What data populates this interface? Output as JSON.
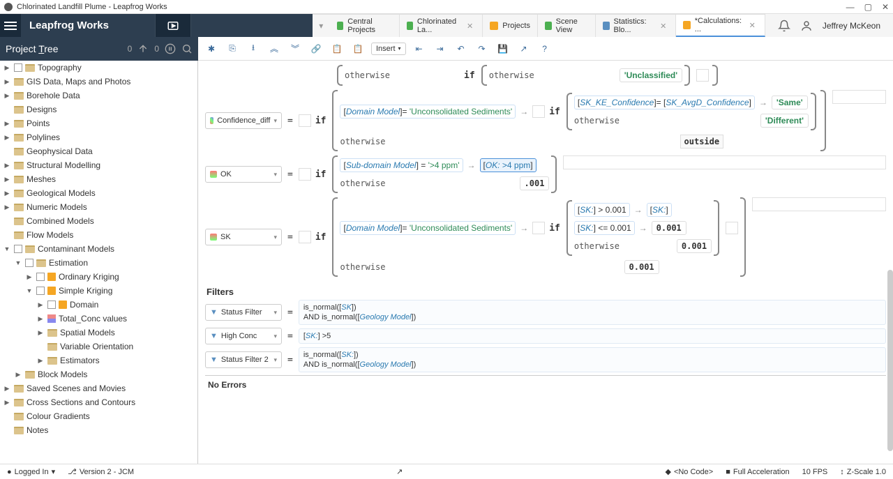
{
  "window": {
    "title": "Chlorinated Landfill Plume - Leapfrog Works",
    "app_name": "Leapfrog Works"
  },
  "user": {
    "name": "Jeffrey McKeon"
  },
  "sidebar": {
    "title_prefix": "Project ",
    "title_underline": "T",
    "title_suffix": "ree",
    "counts": [
      "0",
      "0"
    ]
  },
  "tabs": [
    {
      "label": "Central Projects",
      "color": "#4caf50",
      "closable": false
    },
    {
      "label": "Chlorinated La...",
      "color": "#4caf50",
      "closable": true
    },
    {
      "label": "Projects",
      "color": "#f5a623",
      "closable": false
    },
    {
      "label": "Scene View",
      "color": "#4caf50",
      "closable": false
    },
    {
      "label": "Statistics: Blo...",
      "color": "#5a8fc0",
      "closable": true
    },
    {
      "label": "*Calculations: ...",
      "color": "#f5a623",
      "closable": true,
      "active": true
    }
  ],
  "toolbar": {
    "insert": "Insert"
  },
  "tree": [
    {
      "label": "Topography",
      "indent": 0,
      "expander": "▶",
      "checkbox": true,
      "icon": "folder"
    },
    {
      "label": "GIS Data, Maps and Photos",
      "indent": 0,
      "expander": "▶",
      "checkbox": false,
      "icon": "folder"
    },
    {
      "label": "Borehole Data",
      "indent": 0,
      "expander": "▶",
      "checkbox": false,
      "icon": "folder"
    },
    {
      "label": "Designs",
      "indent": 0,
      "expander": "",
      "checkbox": false,
      "icon": "folder"
    },
    {
      "label": "Points",
      "indent": 0,
      "expander": "▶",
      "checkbox": false,
      "icon": "folder"
    },
    {
      "label": "Polylines",
      "indent": 0,
      "expander": "▶",
      "checkbox": false,
      "icon": "folder"
    },
    {
      "label": "Geophysical Data",
      "indent": 0,
      "expander": "",
      "checkbox": false,
      "icon": "folder"
    },
    {
      "label": "Structural Modelling",
      "indent": 0,
      "expander": "▶",
      "checkbox": false,
      "icon": "folder"
    },
    {
      "label": "Meshes",
      "indent": 0,
      "expander": "▶",
      "checkbox": false,
      "icon": "folder"
    },
    {
      "label": "Geological Models",
      "indent": 0,
      "expander": "▶",
      "checkbox": false,
      "icon": "folder"
    },
    {
      "label": "Numeric Models",
      "indent": 0,
      "expander": "▶",
      "checkbox": false,
      "icon": "folder"
    },
    {
      "label": "Combined Models",
      "indent": 0,
      "expander": "",
      "checkbox": false,
      "icon": "folder"
    },
    {
      "label": "Flow Models",
      "indent": 0,
      "expander": "",
      "checkbox": false,
      "icon": "folder"
    },
    {
      "label": "Contaminant Models",
      "indent": 0,
      "expander": "▼",
      "checkbox": true,
      "icon": "folder"
    },
    {
      "label": "Estimation",
      "indent": 1,
      "expander": "▼",
      "checkbox": true,
      "icon": "folder"
    },
    {
      "label": "Ordinary Kriging",
      "indent": 2,
      "expander": "▶",
      "checkbox": true,
      "icon": "cube"
    },
    {
      "label": "Simple Kriging",
      "indent": 2,
      "expander": "▼",
      "checkbox": true,
      "icon": "cube"
    },
    {
      "label": "Domain",
      "indent": 3,
      "expander": "▶",
      "checkbox": true,
      "icon": "cube"
    },
    {
      "label": "Total_Conc values",
      "indent": 3,
      "expander": "▶",
      "checkbox": false,
      "icon": "grid"
    },
    {
      "label": "Spatial Models",
      "indent": 3,
      "expander": "▶",
      "checkbox": false,
      "icon": "folder"
    },
    {
      "label": "Variable Orientation",
      "indent": 3,
      "expander": "",
      "checkbox": false,
      "icon": "folder"
    },
    {
      "label": "Estimators",
      "indent": 3,
      "expander": "▶",
      "checkbox": false,
      "icon": "folder"
    },
    {
      "label": "Block Models",
      "indent": 1,
      "expander": "▶",
      "checkbox": false,
      "icon": "folder"
    },
    {
      "label": "Saved Scenes and Movies",
      "indent": 0,
      "expander": "▶",
      "checkbox": false,
      "icon": "folder"
    },
    {
      "label": "Cross Sections and Contours",
      "indent": 0,
      "expander": "▶",
      "checkbox": false,
      "icon": "folder"
    },
    {
      "label": "Colour Gradients",
      "indent": 0,
      "expander": "",
      "checkbox": false,
      "icon": "folder"
    },
    {
      "label": "Notes",
      "indent": 0,
      "expander": "",
      "checkbox": false,
      "icon": "folder"
    }
  ],
  "calcs": {
    "row0": {
      "otherwise_top": "otherwise",
      "otherwise_inner": "otherwise",
      "result": "'Unclassified'"
    },
    "confidence_diff": {
      "label": "Confidence_diff",
      "domain_model": "Domain Model",
      "uncon": "'Unconsolidated Sediments'",
      "sk_ke": "SK_KE_Confidence",
      "sk_avgd": "SK_AvgD_Confidence",
      "same": "'Same'",
      "different": "'Different'",
      "otherwise": "otherwise",
      "outside": "outside"
    },
    "ok": {
      "label": "OK",
      "subdomain": "Sub-domain Model",
      "gt4": "'>4 ppm'",
      "ok_ref": "OK:",
      "ok_ref_val": " >4 ppm",
      "point001": ".001",
      "otherwise": "otherwise"
    },
    "sk": {
      "label": "SK",
      "domain_model": "Domain Model",
      "uncon": "'Unconsolidated Sediments'",
      "sk_ref": "SK:",
      "gt": "> 0.001",
      "lte": "<= 0.001",
      "v001": "0.001",
      "otherwise": "otherwise"
    }
  },
  "filters": {
    "header": "Filters",
    "status_filter": {
      "label": "Status Filter",
      "code_l1": "is_normal([",
      "sk": "SK",
      "code_l1_end": "])",
      "code_l2": "AND is_normal([",
      "geo": "Geology Model",
      "code_l2_end": "])"
    },
    "high_conc": {
      "label": "High Conc",
      "code": "[",
      "sk": "SK:",
      "code_end": "] >5"
    },
    "status_filter2": {
      "label": "Status Filter 2",
      "code_l1": "is_normal([",
      "sk": "SK:",
      "code_l1_end": "])",
      "code_l2": "AND is_normal([",
      "geo": "Geology Model",
      "code_l2_end": "])"
    }
  },
  "errors": {
    "header": "No Errors"
  },
  "statusbar": {
    "logged_in": "Logged In",
    "version": "Version 2 - JCM",
    "no_code": "<No Code>",
    "accel": "Full Acceleration",
    "fps": "10 FPS",
    "zscale": "Z-Scale 1.0"
  },
  "misc": {
    "if": "if",
    "equals": "=",
    "arrow": "→",
    "chev_down": "▾"
  }
}
